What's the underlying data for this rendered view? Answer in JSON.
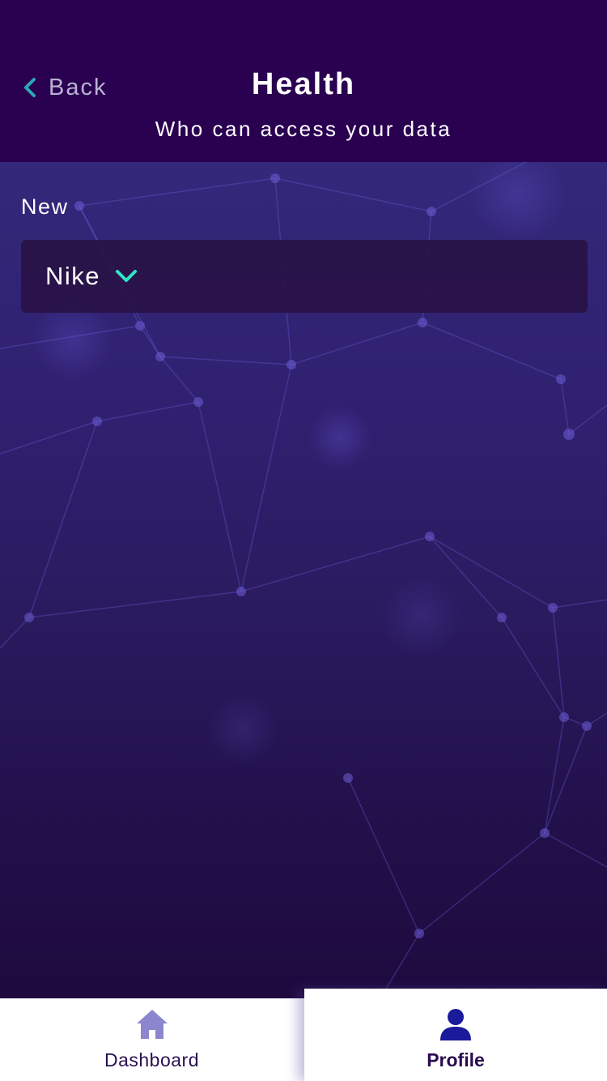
{
  "header": {
    "back_label": "Back",
    "title": "Health",
    "subtitle": "Who can access your data"
  },
  "form": {
    "section_label": "New",
    "select_value": "Nike"
  },
  "tabs": [
    {
      "label": "Dashboard",
      "icon": "home-icon",
      "active": false
    },
    {
      "label": "Profile",
      "icon": "person-icon",
      "active": true
    }
  ],
  "colors": {
    "header_bg": "#2a0050",
    "accent_chevron": "#2ee6c5",
    "tab_icon_inactive": "#8c86cf",
    "tab_icon_active": "#1a1a9a"
  }
}
